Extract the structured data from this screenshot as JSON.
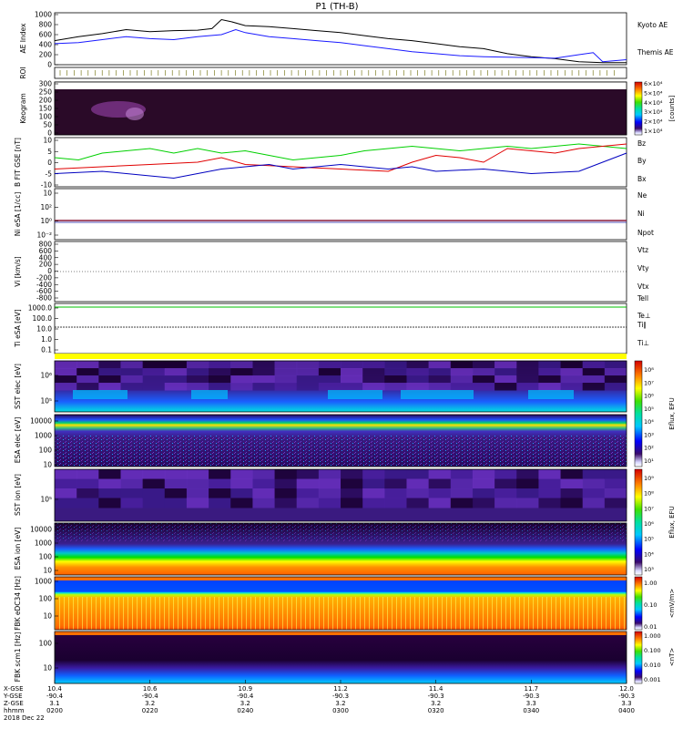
{
  "title": "P1 (TH-B)",
  "colors": {
    "kyoto": "#1a1aff",
    "themis": "#000000",
    "red": "#e00000",
    "green": "#00d000",
    "blue": "#0000c0",
    "yellow": "#ffff00"
  },
  "panels": {
    "ae": {
      "ylabel": "AE Index",
      "ticks": [
        "1000",
        "800",
        "600",
        "400",
        "200",
        "0"
      ],
      "legend": [
        "Kyoto AE",
        "Themis AE"
      ]
    },
    "roi": {
      "ylabel": "ROI"
    },
    "keo": {
      "ylabel": "Keogram",
      "ticks": [
        "300",
        "250",
        "200",
        "150",
        "100",
        "50",
        "0"
      ]
    },
    "bfit": {
      "ylabel": "B FIT GSE [nT]",
      "ticks": [
        "10",
        "5",
        "0",
        "-5",
        "-10"
      ],
      "legend": [
        "Bz",
        "By",
        "Bx"
      ]
    },
    "ni": {
      "ylabel": "Ni eSA [1/cc]",
      "ticks": [
        "10",
        "10²",
        "10⁰",
        "10⁻²"
      ],
      "legend": [
        "Ne",
        "Ni",
        "Npot"
      ]
    },
    "vi": {
      "ylabel": "Vi [km/s]",
      "ticks": [
        "800",
        "600",
        "400",
        "200",
        "0",
        "-200",
        "-400",
        "-600",
        "-800"
      ],
      "legend": [
        "Vtz",
        "Vty",
        "Vtx"
      ]
    },
    "ti": {
      "ylabel": "Ti eSA [eV]",
      "ticks": [
        "1000.0",
        "100.0",
        "10.0",
        "1.0",
        "0.1"
      ],
      "legend": [
        "Tell",
        "Te⊥",
        "Ti∥",
        "Ti⊥"
      ]
    },
    "sst1": {
      "ylabel": "SST elec [eV]",
      "ticks": [
        "10⁶",
        "10⁵"
      ]
    },
    "esa1": {
      "ylabel": "ESA elec [eV]",
      "ticks": [
        "10000",
        "1000",
        "100",
        "10"
      ]
    },
    "sst2": {
      "ylabel": "SST ion [eV]",
      "ticks": [
        "10⁵"
      ]
    },
    "esa2": {
      "ylabel": "ESA ion [eV]",
      "ticks": [
        "10000",
        "1000",
        "100",
        "10"
      ]
    },
    "fbk1": {
      "ylabel": "FBK eDC34 [Hz]",
      "ticks": [
        "1000",
        "100",
        "10"
      ]
    },
    "fbk2": {
      "ylabel": "FBK scm1 [Hz]",
      "ticks": [
        "100",
        "10"
      ]
    }
  },
  "colorbars": {
    "keo": {
      "ticks": [
        "6×10⁴",
        "5×10⁴",
        "4×10⁴",
        "3×10⁴",
        "2×10⁴",
        "1×10⁴"
      ],
      "unit": "[counts]"
    },
    "eflux1": {
      "ticks": [
        "10⁸",
        "10⁷",
        "10⁶",
        "10⁵",
        "10⁴",
        "10³",
        "10²",
        "10¹"
      ],
      "unit": "Eflux, EFU"
    },
    "eflux2": {
      "ticks": [
        "10⁹",
        "10⁸",
        "10⁷",
        "10⁶",
        "10⁵",
        "10⁴",
        "10³"
      ],
      "unit": "Eflux, EFU"
    },
    "fbk1": {
      "ticks": [
        "1.00",
        "0.10",
        "0.01"
      ],
      "unit": "<mV/m>"
    },
    "fbk2": {
      "ticks": [
        "1.000",
        "0.100",
        "0.010",
        "0.001"
      ],
      "unit": "<nT>"
    }
  },
  "chart_data": {
    "type": "line",
    "title": "P1 (TH-B)",
    "time_axis": [
      "0200",
      "0220",
      "0240",
      "0300",
      "0320",
      "0340",
      "0400"
    ],
    "ephemeris_labels": [
      "X-GSE",
      "Y-GSE",
      "Z-GSE",
      "hhmm",
      "2018 Dec 22"
    ],
    "ephemeris": {
      "x_gse": [
        "10.4",
        "10.6",
        "10.9",
        "11.2",
        "11.4",
        "11.7",
        "12.0"
      ],
      "y_gse": [
        "-90.4",
        "-90.4",
        "-90.4",
        "-90.3",
        "-90.3",
        "-90.3",
        "-90.3"
      ],
      "z_gse": [
        "3.1",
        "3.2",
        "3.2",
        "3.2",
        "3.2",
        "3.3",
        "3.3"
      ]
    },
    "ae": {
      "ylim": [
        0,
        1000
      ],
      "themis_ae": [
        [
          0,
          480
        ],
        [
          5,
          560
        ],
        [
          10,
          620
        ],
        [
          15,
          700
        ],
        [
          20,
          660
        ],
        [
          25,
          680
        ],
        [
          30,
          690
        ],
        [
          33,
          720
        ],
        [
          35,
          900
        ],
        [
          37,
          860
        ],
        [
          40,
          780
        ],
        [
          45,
          760
        ],
        [
          50,
          720
        ],
        [
          55,
          680
        ],
        [
          60,
          640
        ],
        [
          65,
          580
        ],
        [
          70,
          520
        ],
        [
          75,
          480
        ],
        [
          80,
          420
        ],
        [
          85,
          360
        ],
        [
          90,
          320
        ],
        [
          95,
          220
        ],
        [
          100,
          160
        ],
        [
          105,
          120
        ],
        [
          110,
          60
        ],
        [
          115,
          40
        ],
        [
          120,
          40
        ]
      ],
      "kyoto_ae": [
        [
          0,
          420
        ],
        [
          5,
          440
        ],
        [
          10,
          500
        ],
        [
          15,
          560
        ],
        [
          20,
          520
        ],
        [
          25,
          500
        ],
        [
          30,
          560
        ],
        [
          35,
          600
        ],
        [
          38,
          700
        ],
        [
          40,
          640
        ],
        [
          45,
          560
        ],
        [
          50,
          520
        ],
        [
          55,
          480
        ],
        [
          60,
          440
        ],
        [
          65,
          380
        ],
        [
          70,
          320
        ],
        [
          75,
          260
        ],
        [
          80,
          220
        ],
        [
          85,
          180
        ],
        [
          90,
          160
        ],
        [
          95,
          150
        ],
        [
          100,
          140
        ],
        [
          105,
          130
        ],
        [
          110,
          200
        ],
        [
          113,
          240
        ],
        [
          115,
          60
        ],
        [
          120,
          100
        ]
      ]
    },
    "b_fit_gse": {
      "ylim": [
        -10,
        10
      ],
      "bz": [
        [
          0,
          -3
        ],
        [
          10,
          -2
        ],
        [
          20,
          -1
        ],
        [
          30,
          0
        ],
        [
          35,
          2
        ],
        [
          40,
          -1
        ],
        [
          50,
          -2
        ],
        [
          60,
          -3
        ],
        [
          70,
          -4
        ],
        [
          75,
          0
        ],
        [
          80,
          3
        ],
        [
          85,
          2
        ],
        [
          90,
          0
        ],
        [
          95,
          6
        ],
        [
          100,
          5
        ],
        [
          105,
          4
        ],
        [
          110,
          6
        ],
        [
          115,
          7
        ],
        [
          120,
          8
        ]
      ],
      "by": [
        [
          0,
          2
        ],
        [
          5,
          1
        ],
        [
          10,
          4
        ],
        [
          15,
          5
        ],
        [
          20,
          6
        ],
        [
          25,
          4
        ],
        [
          30,
          6
        ],
        [
          35,
          4
        ],
        [
          40,
          5
        ],
        [
          45,
          3
        ],
        [
          50,
          1
        ],
        [
          55,
          2
        ],
        [
          60,
          3
        ],
        [
          65,
          5
        ],
        [
          70,
          6
        ],
        [
          75,
          7
        ],
        [
          80,
          6
        ],
        [
          85,
          5
        ],
        [
          90,
          6
        ],
        [
          95,
          7
        ],
        [
          100,
          6
        ],
        [
          105,
          7
        ],
        [
          110,
          8
        ],
        [
          115,
          7
        ],
        [
          120,
          6
        ]
      ],
      "bx": [
        [
          0,
          -5
        ],
        [
          10,
          -4
        ],
        [
          20,
          -6
        ],
        [
          25,
          -7
        ],
        [
          30,
          -5
        ],
        [
          35,
          -3
        ],
        [
          40,
          -2
        ],
        [
          45,
          -1
        ],
        [
          50,
          -3
        ],
        [
          55,
          -2
        ],
        [
          60,
          -1
        ],
        [
          65,
          -2
        ],
        [
          70,
          -3
        ],
        [
          75,
          -2
        ],
        [
          80,
          -4
        ],
        [
          90,
          -3
        ],
        [
          100,
          -5
        ],
        [
          110,
          -4
        ],
        [
          115,
          0
        ],
        [
          120,
          4
        ]
      ]
    }
  }
}
